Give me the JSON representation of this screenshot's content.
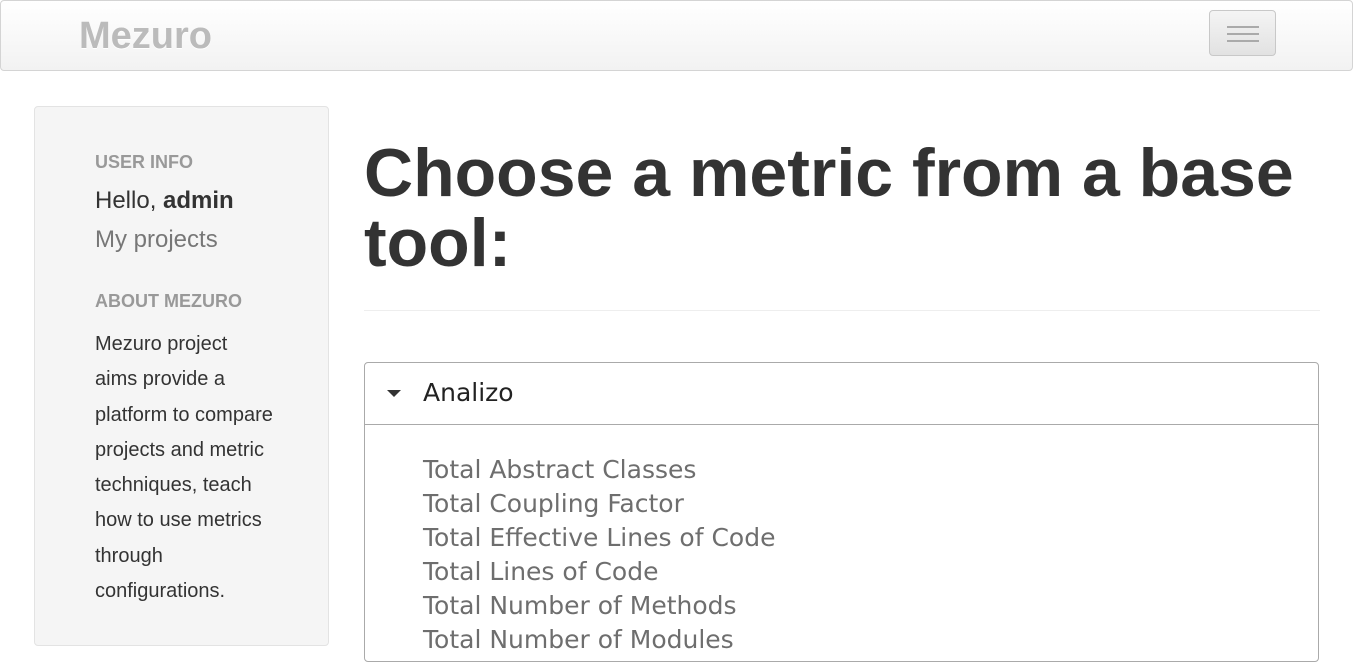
{
  "navbar": {
    "brand": "Mezuro"
  },
  "sidebar": {
    "user_info_header": "USER INFO",
    "hello": "Hello, ",
    "username": "admin",
    "my_projects": "My projects",
    "about_header": "ABOUT MEZURO",
    "about_text": "Mezuro project aims provide a platform to compare projects and metric techniques, teach how to use metrics through configurations."
  },
  "main": {
    "title": "Choose a metric from a base tool:",
    "accordion": {
      "title": "Analizo",
      "metrics": [
        "Total Abstract Classes",
        "Total Coupling Factor",
        "Total Effective Lines of Code",
        "Total Lines of Code",
        "Total Number of Methods",
        "Total Number of Modules"
      ]
    }
  }
}
